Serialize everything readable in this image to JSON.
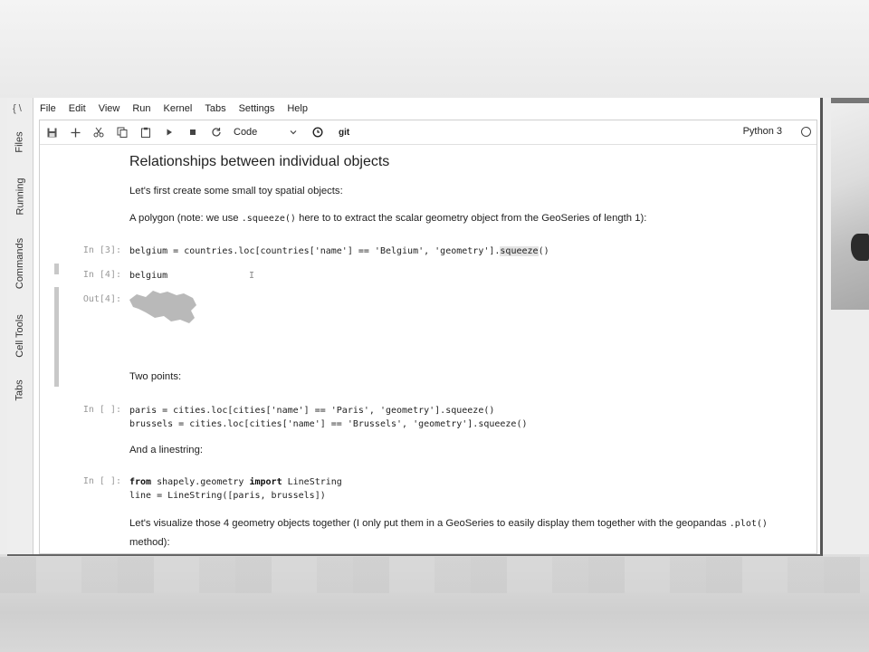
{
  "leftbar": {
    "logo": "{ \\",
    "tabs": [
      "Files",
      "Running",
      "Commands",
      "Cell Tools",
      "Tabs"
    ]
  },
  "menubar": [
    "File",
    "Edit",
    "View",
    "Run",
    "Kernel",
    "Tabs",
    "Settings",
    "Help"
  ],
  "toolbar": {
    "cell_type": "Code",
    "git_label": "git",
    "kernel_name": "Python 3"
  },
  "notebook": {
    "heading": "Relationships between individual objects",
    "intro": "Let's first create some small toy spatial objects:",
    "polygon_pre": "A polygon (note: we use ",
    "polygon_code": ".squeeze()",
    "polygon_post": " here to to extract the scalar geometry object from the GeoSeries of length 1):",
    "cell1": {
      "prompt": "In [3]:",
      "code_pre": "belgium = countries.loc[countries['name'] == 'Belgium', 'geometry'].",
      "code_hl": "squeeze",
      "code_post": "()"
    },
    "cell2": {
      "prompt": "In [4]:",
      "code": "belgium",
      "cursor_char": "I",
      "out_prompt": "Out[4]:"
    },
    "two_points": "Two points:",
    "cell3": {
      "prompt": "In [ ]:",
      "line1": "paris = cities.loc[cities['name'] == 'Paris', 'geometry'].squeeze()",
      "line2": "brussels = cities.loc[cities['name'] == 'Brussels', 'geometry'].squeeze()"
    },
    "linestring": "And a linestring:",
    "cell4": {
      "prompt": "In [ ]:",
      "kw_from": "from",
      "module": " shapely.geometry ",
      "kw_import": "import",
      "name": " LineString",
      "line2": "line = LineString([paris, brussels])"
    },
    "visualize_pre": "Let's visualize those 4 geometry objects together (I only put them in a GeoSeries to easily display them together with the geopandas ",
    "visualize_code": ".plot()",
    "visualize_post": "method):"
  }
}
